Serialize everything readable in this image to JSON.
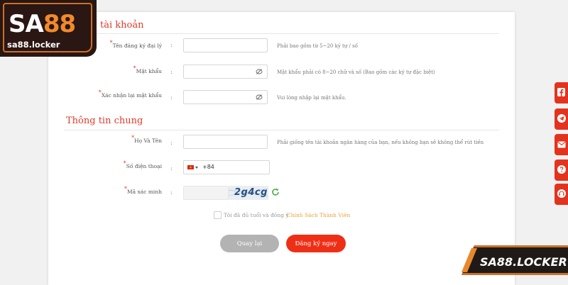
{
  "logo": {
    "brand_prefix": "SA",
    "brand_number": "88",
    "domain": "sa88.locker"
  },
  "account_section": {
    "title": "tài khoản"
  },
  "fields": {
    "agent_username": {
      "label": "Tên đăng ký đại lý",
      "value": "",
      "hint": "Phải bao gồm từ 5~20 ký tự / số"
    },
    "password": {
      "label": "Mật khẩu",
      "value": "",
      "hint": "Mật khẩu phải có 8~20 chữ và số (Bao gồm các ký tự đặc biệt)"
    },
    "confirm_password": {
      "label": "Xác nhận lại mật khẩu",
      "value": "",
      "hint": "Vui lòng nhập lại mật khẩu."
    },
    "full_name": {
      "label": "Họ Và Tên",
      "value": "",
      "hint": "Phải giống tên tài khoản ngân hàng của bạn, nếu không bạn sẽ không thể rút tiền"
    },
    "phone": {
      "label": "Số điện thoại",
      "prefix": "+84",
      "value": ""
    },
    "captcha": {
      "label": "Mã xác minh",
      "value": "",
      "code": "2g4cg"
    }
  },
  "general_section": {
    "title": "Thông tin chung"
  },
  "agreement": {
    "text": "Tôi đã đủ tuổi và đồng ý",
    "link": "Chính Sách Thành Viên",
    "checked": false
  },
  "buttons": {
    "back": "Quay lại",
    "register": "Đăng ký ngay"
  },
  "banner": {
    "text": "SA88.LOCKER"
  },
  "colors": {
    "accent": "#e03a2a",
    "button_red": "#ee2f16",
    "button_gray": "#b3b3b3",
    "link": "#e8a33a",
    "logo_orange": "#f08a2c"
  },
  "side_icons": [
    "facebook-icon",
    "telegram-icon",
    "mail-icon",
    "help-icon",
    "headset-icon"
  ]
}
